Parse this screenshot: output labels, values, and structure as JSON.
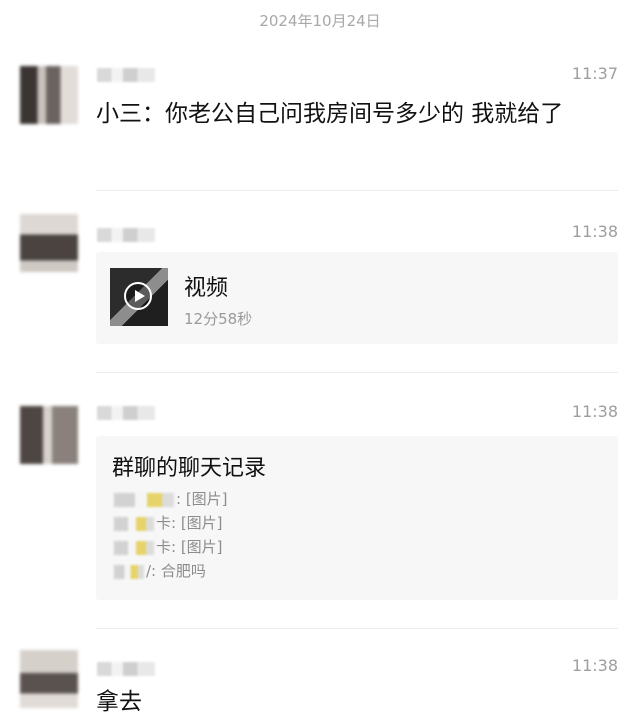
{
  "date_separator": "2024年10月24日",
  "messages": [
    {
      "time": "11:37",
      "text": "小三：你老公自己问我房间号多少的 我就给了"
    },
    {
      "time": "11:38",
      "video": {
        "title": "视频",
        "duration": "12分58秒",
        "icon": "play-icon"
      }
    },
    {
      "time": "11:38",
      "chat_record": {
        "title": "群聊的聊天记录",
        "lines": [
          {
            "text": ": [图片]"
          },
          {
            "text": "卡: [图片]"
          },
          {
            "text": "卡: [图片]"
          },
          {
            "text": "/: 合肥吗"
          }
        ]
      }
    },
    {
      "time": "11:38",
      "text": "拿去"
    }
  ]
}
